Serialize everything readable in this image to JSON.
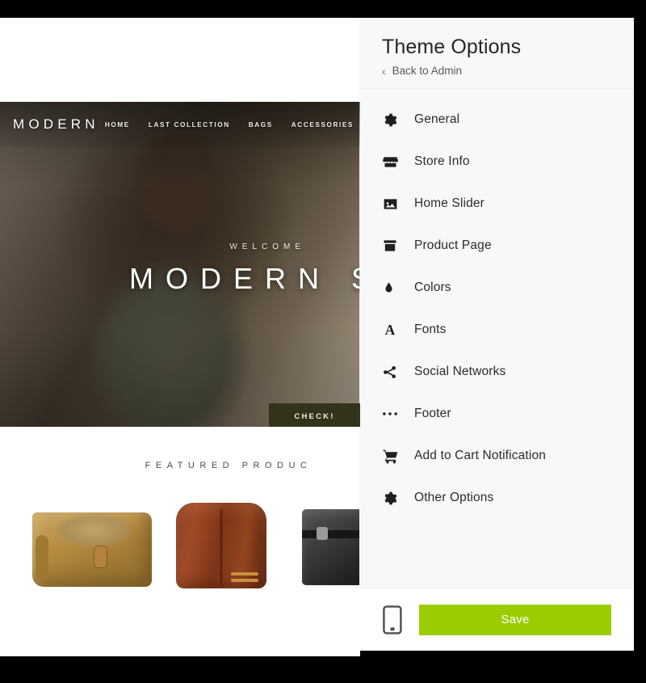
{
  "panel": {
    "title": "Theme Options",
    "back_label": "Back to Admin",
    "back_icon": "chevron-left-icon",
    "menu": [
      {
        "label": "General",
        "icon": "gear-icon"
      },
      {
        "label": "Store Info",
        "icon": "store-icon"
      },
      {
        "label": "Home Slider",
        "icon": "image-icon"
      },
      {
        "label": "Product Page",
        "icon": "archive-box-icon"
      },
      {
        "label": "Colors",
        "icon": "droplet-icon"
      },
      {
        "label": "Fonts",
        "icon": "letter-a-icon"
      },
      {
        "label": "Social Networks",
        "icon": "share-nodes-icon"
      },
      {
        "label": "Footer",
        "icon": "ellipsis-icon"
      },
      {
        "label": "Add to Cart Notification",
        "icon": "shopping-cart-icon"
      },
      {
        "label": "Other Options",
        "icon": "gear-icon"
      }
    ],
    "footer": {
      "phone_icon": "mobile-phone-icon",
      "save_label": "Save",
      "save_color": "#9ACD01"
    }
  },
  "preview": {
    "logo": "MODERN",
    "nav": [
      "HOME",
      "LAST COLLECTION",
      "BAGS",
      "ACCESSORIES"
    ],
    "hero": {
      "eyebrow": "WELCOME",
      "title": "MODERN S",
      "button": "CHECK!",
      "button_color": "#33331b"
    },
    "featured": {
      "title": "FEATURED PRODUC",
      "products": [
        "tan-canvas-bag",
        "brown-leather-jacket",
        "black-bag"
      ]
    }
  }
}
